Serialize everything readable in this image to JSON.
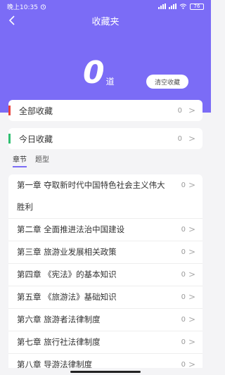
{
  "status_bar": {
    "time": "晚上10:35",
    "battery": "76"
  },
  "nav": {
    "title": "收藏夹"
  },
  "summary": {
    "count": "0",
    "unit": "道",
    "clear_label": "清空收藏"
  },
  "cards": [
    {
      "label": "全部收藏",
      "count": "0",
      "accent": "#e8413c"
    },
    {
      "label": "今日收藏",
      "count": "0",
      "accent": "#2fbf71"
    }
  ],
  "tabs": [
    {
      "label": "章节",
      "active": true
    },
    {
      "label": "题型",
      "active": false
    }
  ],
  "chapters": [
    {
      "label": "第一章 夺取新时代中国特色社会主义伟大胜利",
      "count": "0"
    },
    {
      "label": "第二章 全面推进法治中国建设",
      "count": "0"
    },
    {
      "label": "第三章 旅游业发展相关政策",
      "count": "0"
    },
    {
      "label": "第四章 《宪法》的基本知识",
      "count": "0"
    },
    {
      "label": "第五章 《旅游法》基础知识",
      "count": "0"
    },
    {
      "label": "第六章 旅游者法律制度",
      "count": "0"
    },
    {
      "label": "第七章 旅行社法律制度",
      "count": "0"
    },
    {
      "label": "第八章 导游法律制度",
      "count": "0"
    }
  ],
  "colors": {
    "primary": "#7b6cf6",
    "background": "#f4f4f6"
  },
  "icons": {
    "back": "chevron-left-icon",
    "row_arrow": "chevron-right-icon"
  }
}
